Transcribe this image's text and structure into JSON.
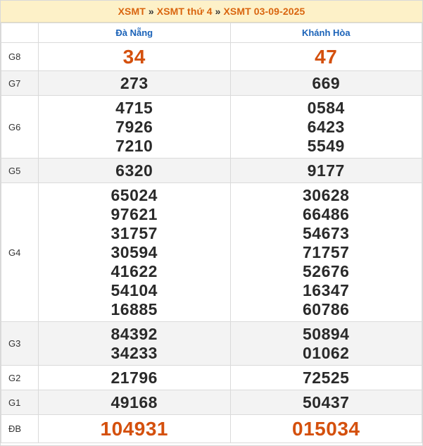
{
  "breadcrumb": {
    "item1": "XSMT",
    "item2": "XSMT thứ 4",
    "item3": "XSMT 03-09-2025",
    "separator": "»"
  },
  "header": {
    "col1": "",
    "col2": "Đà Nẵng",
    "col3": "Khánh Hòa"
  },
  "rows": [
    {
      "label": "G8",
      "danang": [
        "34"
      ],
      "khanhhoa": [
        "47"
      ]
    },
    {
      "label": "G7",
      "danang": [
        "273"
      ],
      "khanhhoa": [
        "669"
      ]
    },
    {
      "label": "G6",
      "danang": [
        "4715",
        "7926",
        "7210"
      ],
      "khanhhoa": [
        "0584",
        "6423",
        "5549"
      ]
    },
    {
      "label": "G5",
      "danang": [
        "6320"
      ],
      "khanhhoa": [
        "9177"
      ]
    },
    {
      "label": "G4",
      "danang": [
        "65024",
        "97621",
        "31757",
        "30594",
        "41622",
        "54104",
        "16885"
      ],
      "khanhhoa": [
        "30628",
        "66486",
        "54673",
        "71757",
        "52676",
        "16347",
        "60786"
      ]
    },
    {
      "label": "G3",
      "danang": [
        "84392",
        "34233"
      ],
      "khanhhoa": [
        "50894",
        "01062"
      ]
    },
    {
      "label": "G2",
      "danang": [
        "21796"
      ],
      "khanhhoa": [
        "72525"
      ]
    },
    {
      "label": "G1",
      "danang": [
        "49168"
      ],
      "khanhhoa": [
        "50437"
      ]
    },
    {
      "label": "ĐB",
      "danang": [
        "104931"
      ],
      "khanhhoa": [
        "015034"
      ]
    }
  ],
  "colors": {
    "accent": "#d9650f",
    "prize_highlight": "#d4500d",
    "header_text": "#1a62b8",
    "breadcrumb_bg": "#fdf1c8"
  }
}
